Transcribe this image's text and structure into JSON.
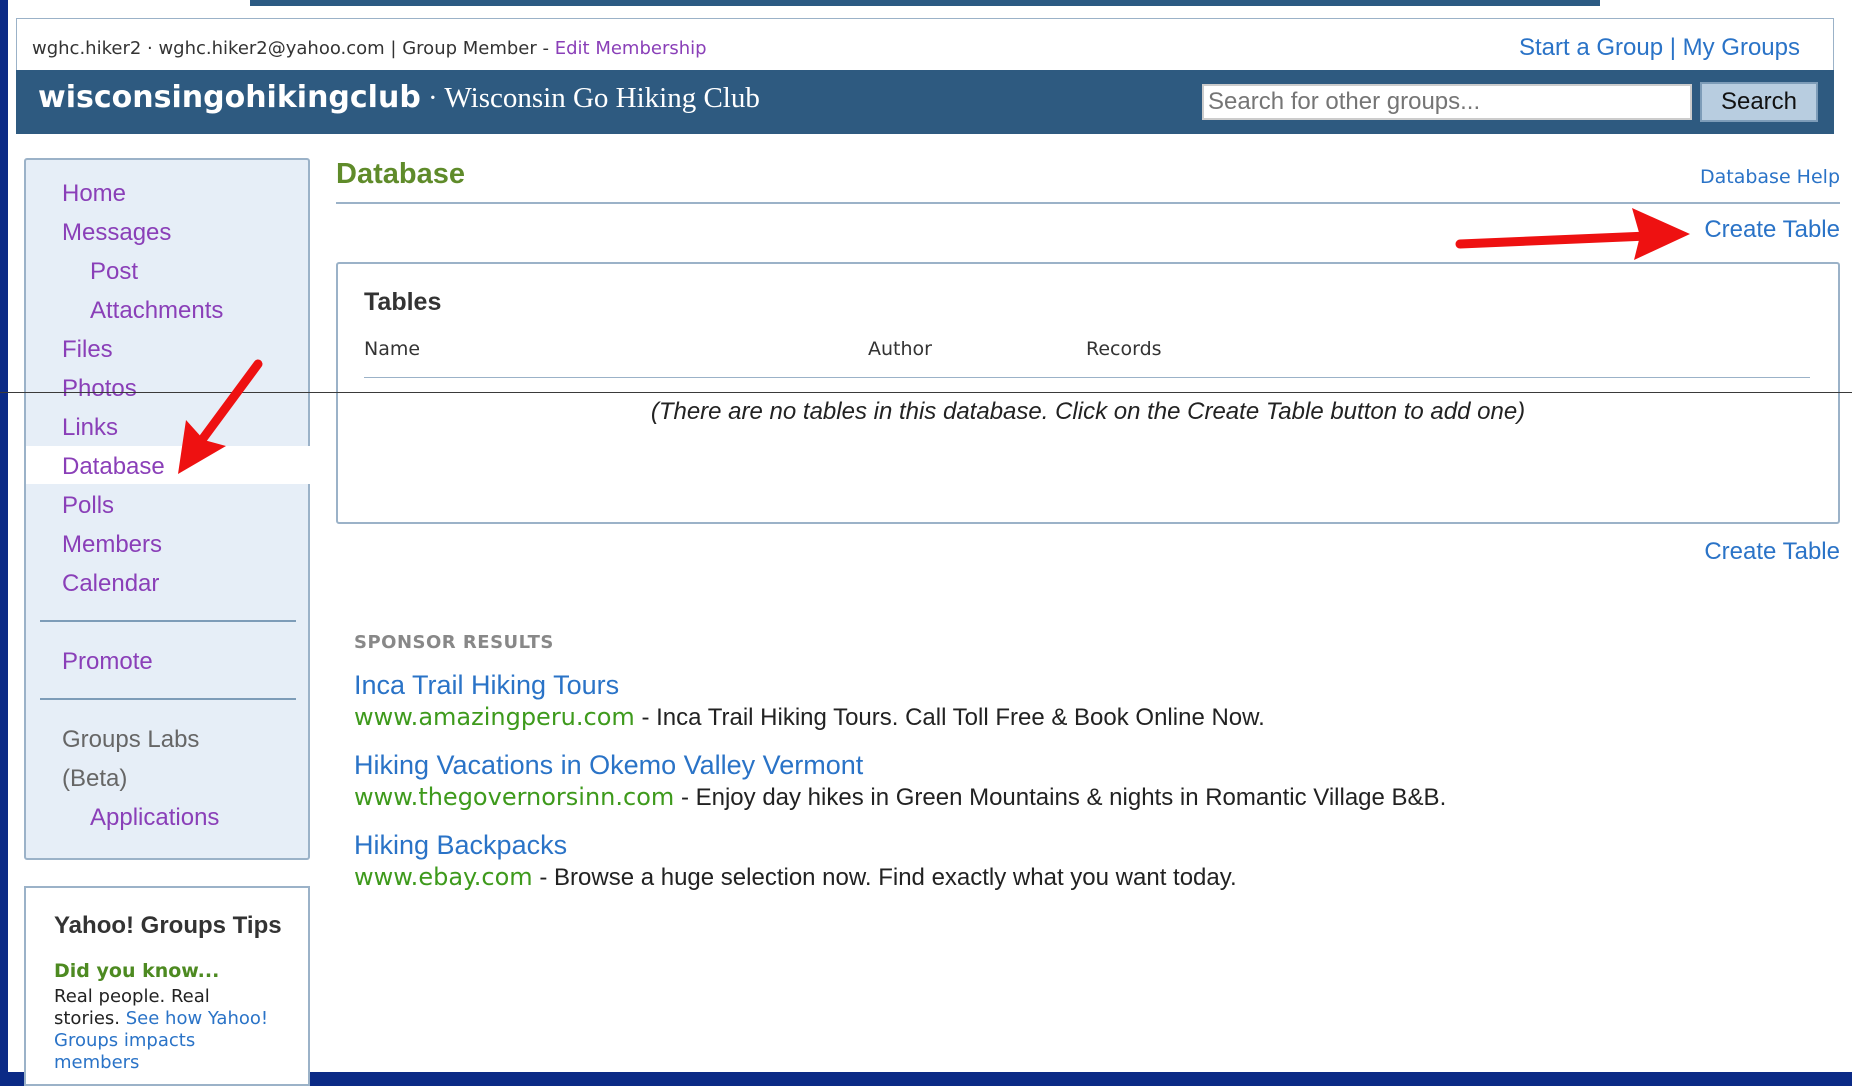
{
  "user": {
    "info": "wghc.hiker2 · wghc.hiker2@yahoo.com | Group Member",
    "sep": " - ",
    "edit_membership": "Edit Membership"
  },
  "toplinks": {
    "start": "Start a Group",
    "divider": " | ",
    "my_groups": "My Groups"
  },
  "header": {
    "group_id": "wisconsingohikingclub",
    "group_name": " · Wisconsin Go Hiking Club"
  },
  "search": {
    "placeholder": "Search for other groups...",
    "button": "Search"
  },
  "nav": {
    "home": "Home",
    "messages": "Messages",
    "post": "Post",
    "attachments": "Attachments",
    "files": "Files",
    "photos": "Photos",
    "links": "Links",
    "database": "Database",
    "polls": "Polls",
    "members": "Members",
    "calendar": "Calendar",
    "promote": "Promote",
    "labs1": "Groups Labs",
    "labs2": "(Beta)",
    "applications": "Applications"
  },
  "tips": {
    "title": "Yahoo! Groups Tips",
    "subtitle": "Did you know...",
    "body": "Real people. Real stories. ",
    "link": "See how Yahoo! Groups impacts members"
  },
  "main": {
    "title": "Database",
    "help": "Database Help",
    "create_table": "Create Table",
    "tables_title": "Tables",
    "columns": [
      "Name",
      "Author",
      "Records"
    ],
    "empty_msg": "(There are no tables in this database. Click on the Create Table button to add one)"
  },
  "sponsor": {
    "heading": "SPONSOR RESULTS",
    "ads": [
      {
        "title": "Inca Trail Hiking Tours",
        "url": "www.amazingperu.com",
        "desc": " - Inca Trail Hiking Tours. Call Toll Free & Book Online Now."
      },
      {
        "title": "Hiking Vacations in Okemo Valley Vermont",
        "url": "www.thegovernorsinn.com",
        "desc": " - Enjoy day hikes in Green Mountains & nights in Romantic Village B&B."
      },
      {
        "title": "Hiking Backpacks",
        "url": "www.ebay.com",
        "desc": " - Browse a huge selection now. Find exactly what you want today."
      }
    ]
  },
  "colors": {
    "accent_red": "#ee1111",
    "header_blue": "#2e5a80",
    "link_purple": "#8a3fb8"
  }
}
